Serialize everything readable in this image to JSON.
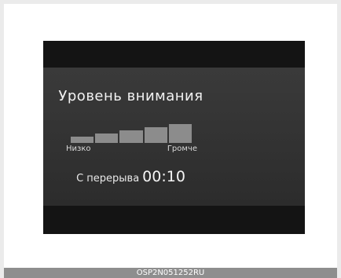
{
  "display": {
    "title": "Уровень внимания",
    "meter": {
      "low_label": "Низко",
      "high_label": "Громче",
      "segments": 5,
      "level": 5
    },
    "break": {
      "label": "С перерыва",
      "time": "00:10"
    }
  },
  "caption": "OSP2N051252RU",
  "colors": {
    "screen_background": "#1e1e1e",
    "panel_background": "#333333",
    "meter_fill": "#8c8c8c",
    "text": "#f2f2f2",
    "caption_bar": "#8e8e8e"
  }
}
